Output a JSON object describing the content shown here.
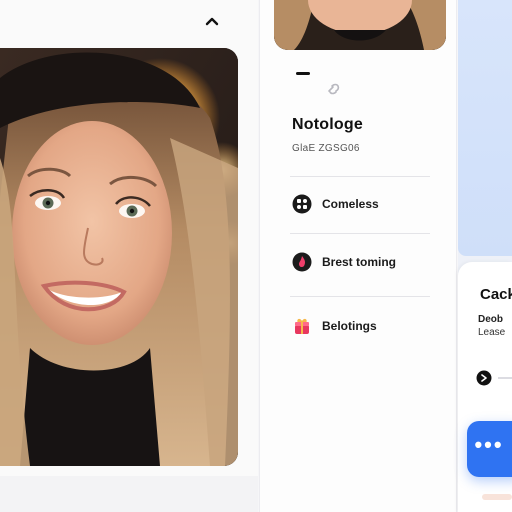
{
  "left": {
    "top_icon": "chevron-up-icon",
    "photo_subject": "portrait-photo"
  },
  "middle": {
    "dash_icon": "minus-icon",
    "link_icon": "link-icon",
    "title": "Notologe",
    "subtitle": "GlaE ZGSG06",
    "menu": [
      {
        "label": "Comeless",
        "icon": "grid-circle-icon"
      },
      {
        "label": "Brest toming",
        "icon": "flame-circle-icon"
      },
      {
        "label": "Belotings",
        "icon": "gift-icon"
      }
    ]
  },
  "right": {
    "title": "Cack",
    "line1": "Deob",
    "line2": "Lease",
    "radio_icon": "radio-selected-icon",
    "fab_label": "•••",
    "colors": {
      "accent": "#2f73f2",
      "panel_blue": "#d8e5fb"
    }
  }
}
